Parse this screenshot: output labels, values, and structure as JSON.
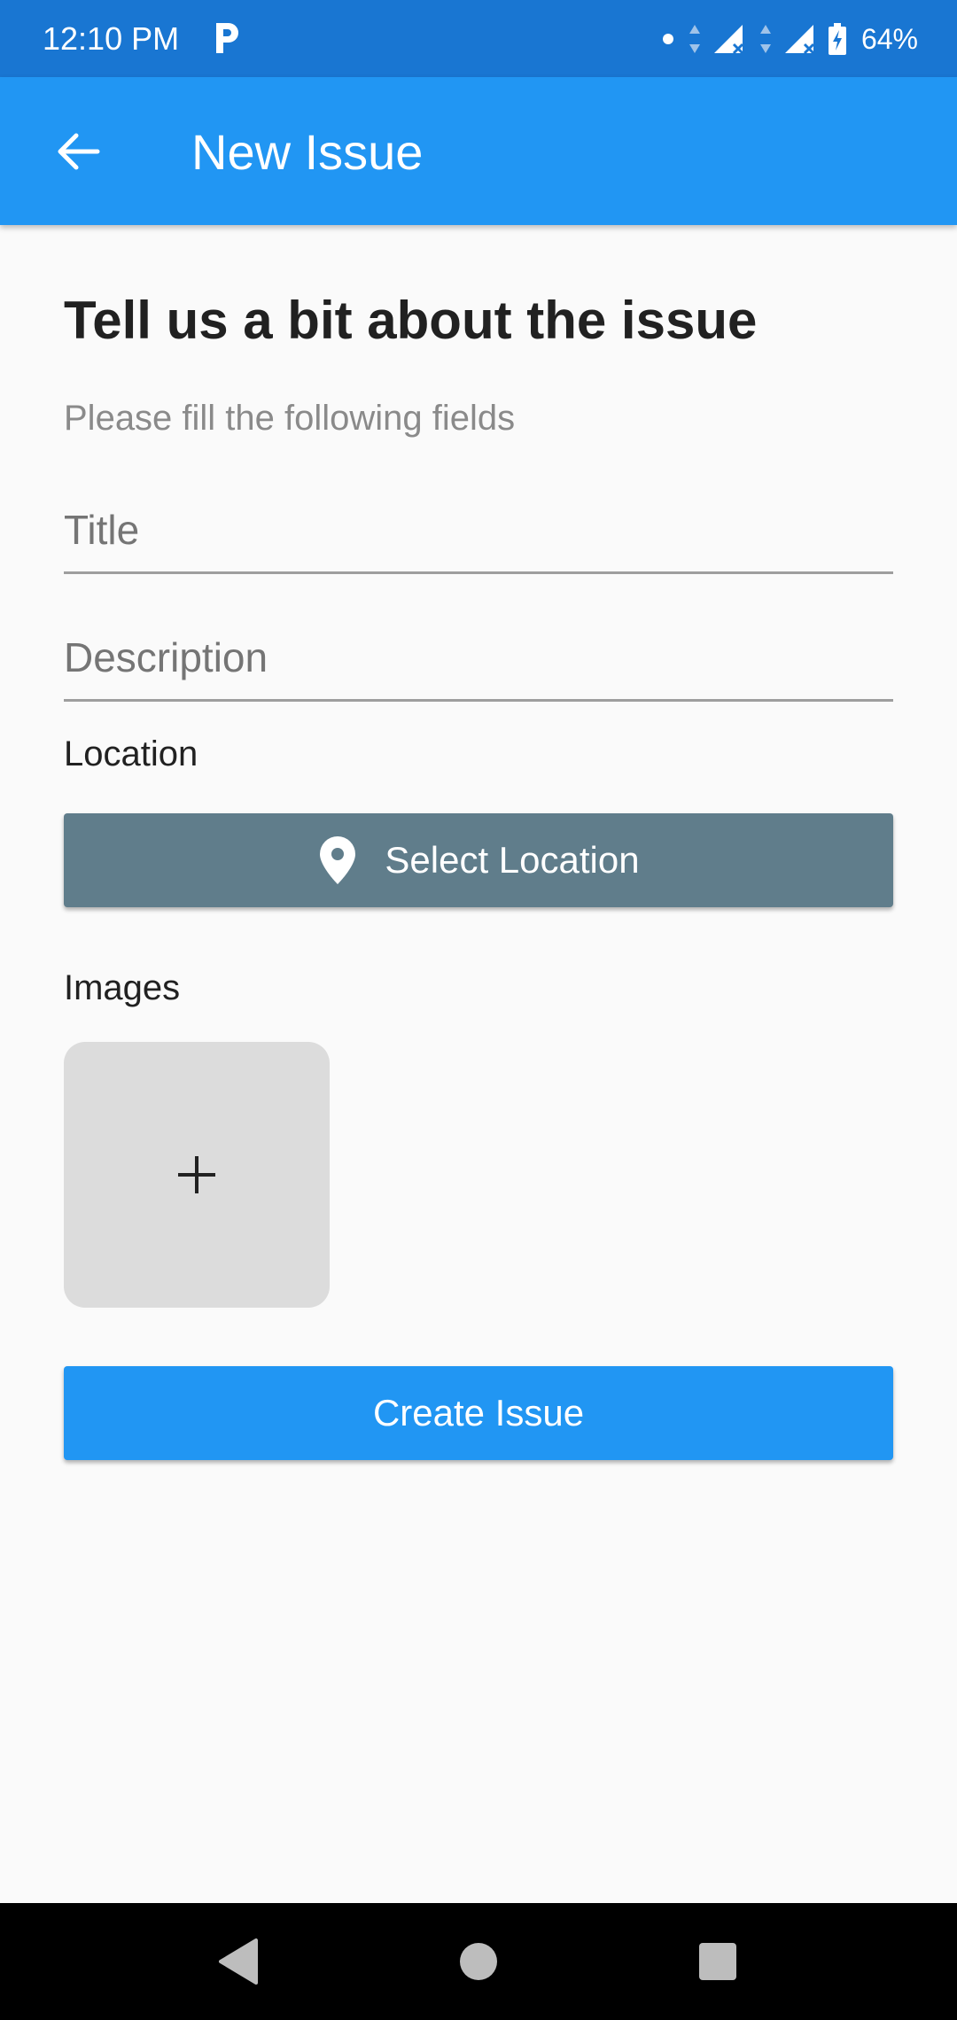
{
  "status_bar": {
    "time": "12:10 PM",
    "battery": "64%",
    "icons": [
      "parking-app-icon",
      "dot-icon",
      "data-arrows-icon",
      "signal-x-icon",
      "signal-x-icon",
      "battery-charging-icon"
    ]
  },
  "app_bar": {
    "title": "New Issue",
    "back_icon": "arrow-left-icon"
  },
  "form": {
    "heading": "Tell us a bit about the issue",
    "subheading": "Please fill the following fields",
    "title_field": {
      "placeholder": "Title",
      "value": ""
    },
    "description_field": {
      "placeholder": "Description",
      "value": ""
    },
    "location_label": "Location",
    "location_button": "Select Location",
    "location_icon": "map-pin-icon",
    "images_label": "Images",
    "add_image_icon": "plus-icon",
    "create_button": "Create Issue"
  },
  "colors": {
    "status_bar": "#1976d2",
    "app_bar": "#2196f3",
    "location_button": "#607d8b",
    "create_button": "#2196f3",
    "image_tile": "#dcdcdc"
  },
  "nav_bar": {
    "icons": [
      "back-triangle-icon",
      "home-circle-icon",
      "recents-square-icon"
    ]
  }
}
